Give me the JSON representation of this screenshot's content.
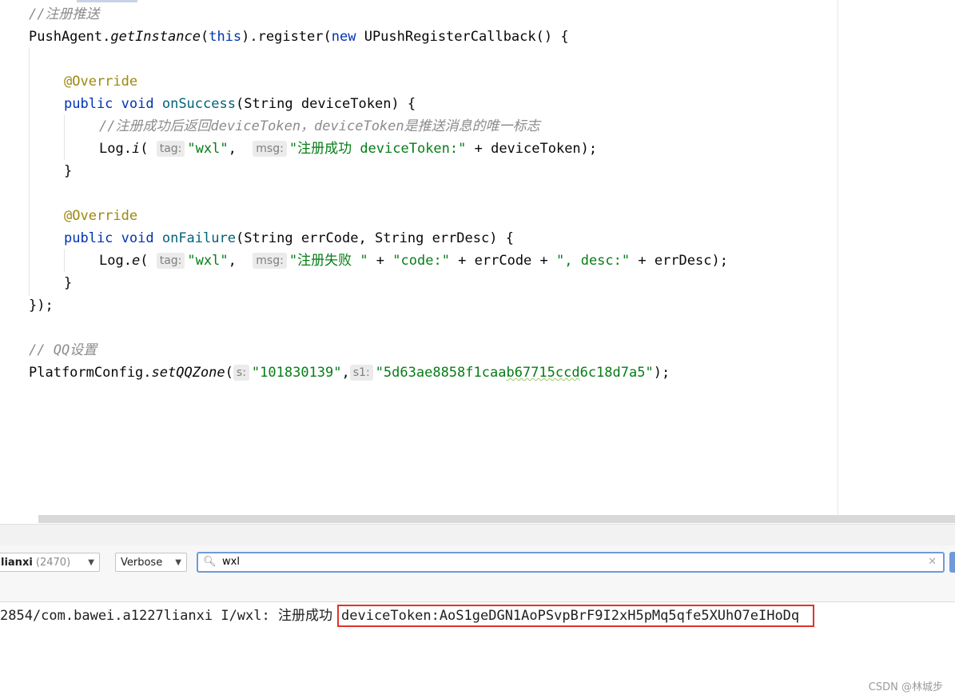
{
  "editor": {
    "lines": {
      "l1_comment": "//注册推送",
      "l2_a": "PushAgent.",
      "l2_b": "getInstance",
      "l2_c": "(",
      "l2_d": "this",
      "l2_e": ").register(",
      "l2_f": "new",
      "l2_g": " UPushRegisterCallback() {",
      "l4_annot": "@Override",
      "l5_a": "public void",
      "l5_b": "onSuccess",
      "l5_c": "(String deviceToken) {",
      "l6_comment": "//注册成功后返回deviceToken，deviceToken是推送消息的唯一标志",
      "l7_a": "Log.",
      "l7_b": "i",
      "l7_c": "(",
      "l7_hint1": "tag:",
      "l7_s1": "\"wxl\"",
      "l7_d": ", ",
      "l7_hint2": "msg:",
      "l7_s2": "\"注册成功 deviceToken:\"",
      "l7_e": " + deviceToken);",
      "l8_close": "}",
      "l10_annot": "@Override",
      "l11_a": "public void",
      "l11_b": "onFailure",
      "l11_c": "(String errCode, String errDesc) {",
      "l12_a": "Log.",
      "l12_b": "e",
      "l12_c": "(",
      "l12_hint1": "tag:",
      "l12_s1": "\"wxl\"",
      "l12_d": ", ",
      "l12_hint2": "msg:",
      "l12_s2": "\"注册失败 \"",
      "l12_e": " + ",
      "l12_s3": "\"code:\"",
      "l12_f": " + errCode + ",
      "l12_s4": "\", desc:\"",
      "l12_g": " + errDesc);",
      "l13_close": "}",
      "l14_close": "});",
      "l16_comment": "// QQ设置",
      "l17_a": "PlatformConfig.",
      "l17_b": "setQQZone",
      "l17_c": "(",
      "l17_hint1": "s:",
      "l17_s1": "\"101830139\"",
      "l17_d": ",",
      "l17_hint2": "s1:",
      "l17_s2_pre": "\"5d63ae8858f1caa",
      "l17_s2_sq": "b67715ccd",
      "l17_s2_post": "6c18d7a5\"",
      "l17_e": ");"
    }
  },
  "logcat": {
    "process_name": "lianxi",
    "process_count": "(2470)",
    "level": "Verbose",
    "search_value": "wxl",
    "log_prefix": "2854/com.bawei.a1227lianxi I/wxl: 注册成功",
    "log_token": "deviceToken:AoS1geDGN1AoPSvpBrF9I2xH5pMq5qfe5XUhO7eIHoDq"
  },
  "watermark": "CSDN @林城步",
  "colors": {
    "keyword": "#0033b3",
    "string": "#067d17",
    "annotation": "#9e880d",
    "comment": "#8c8c8c",
    "method": "#00627a",
    "highlight_border": "#e1322e",
    "search_focus": "#6e9bd8"
  }
}
